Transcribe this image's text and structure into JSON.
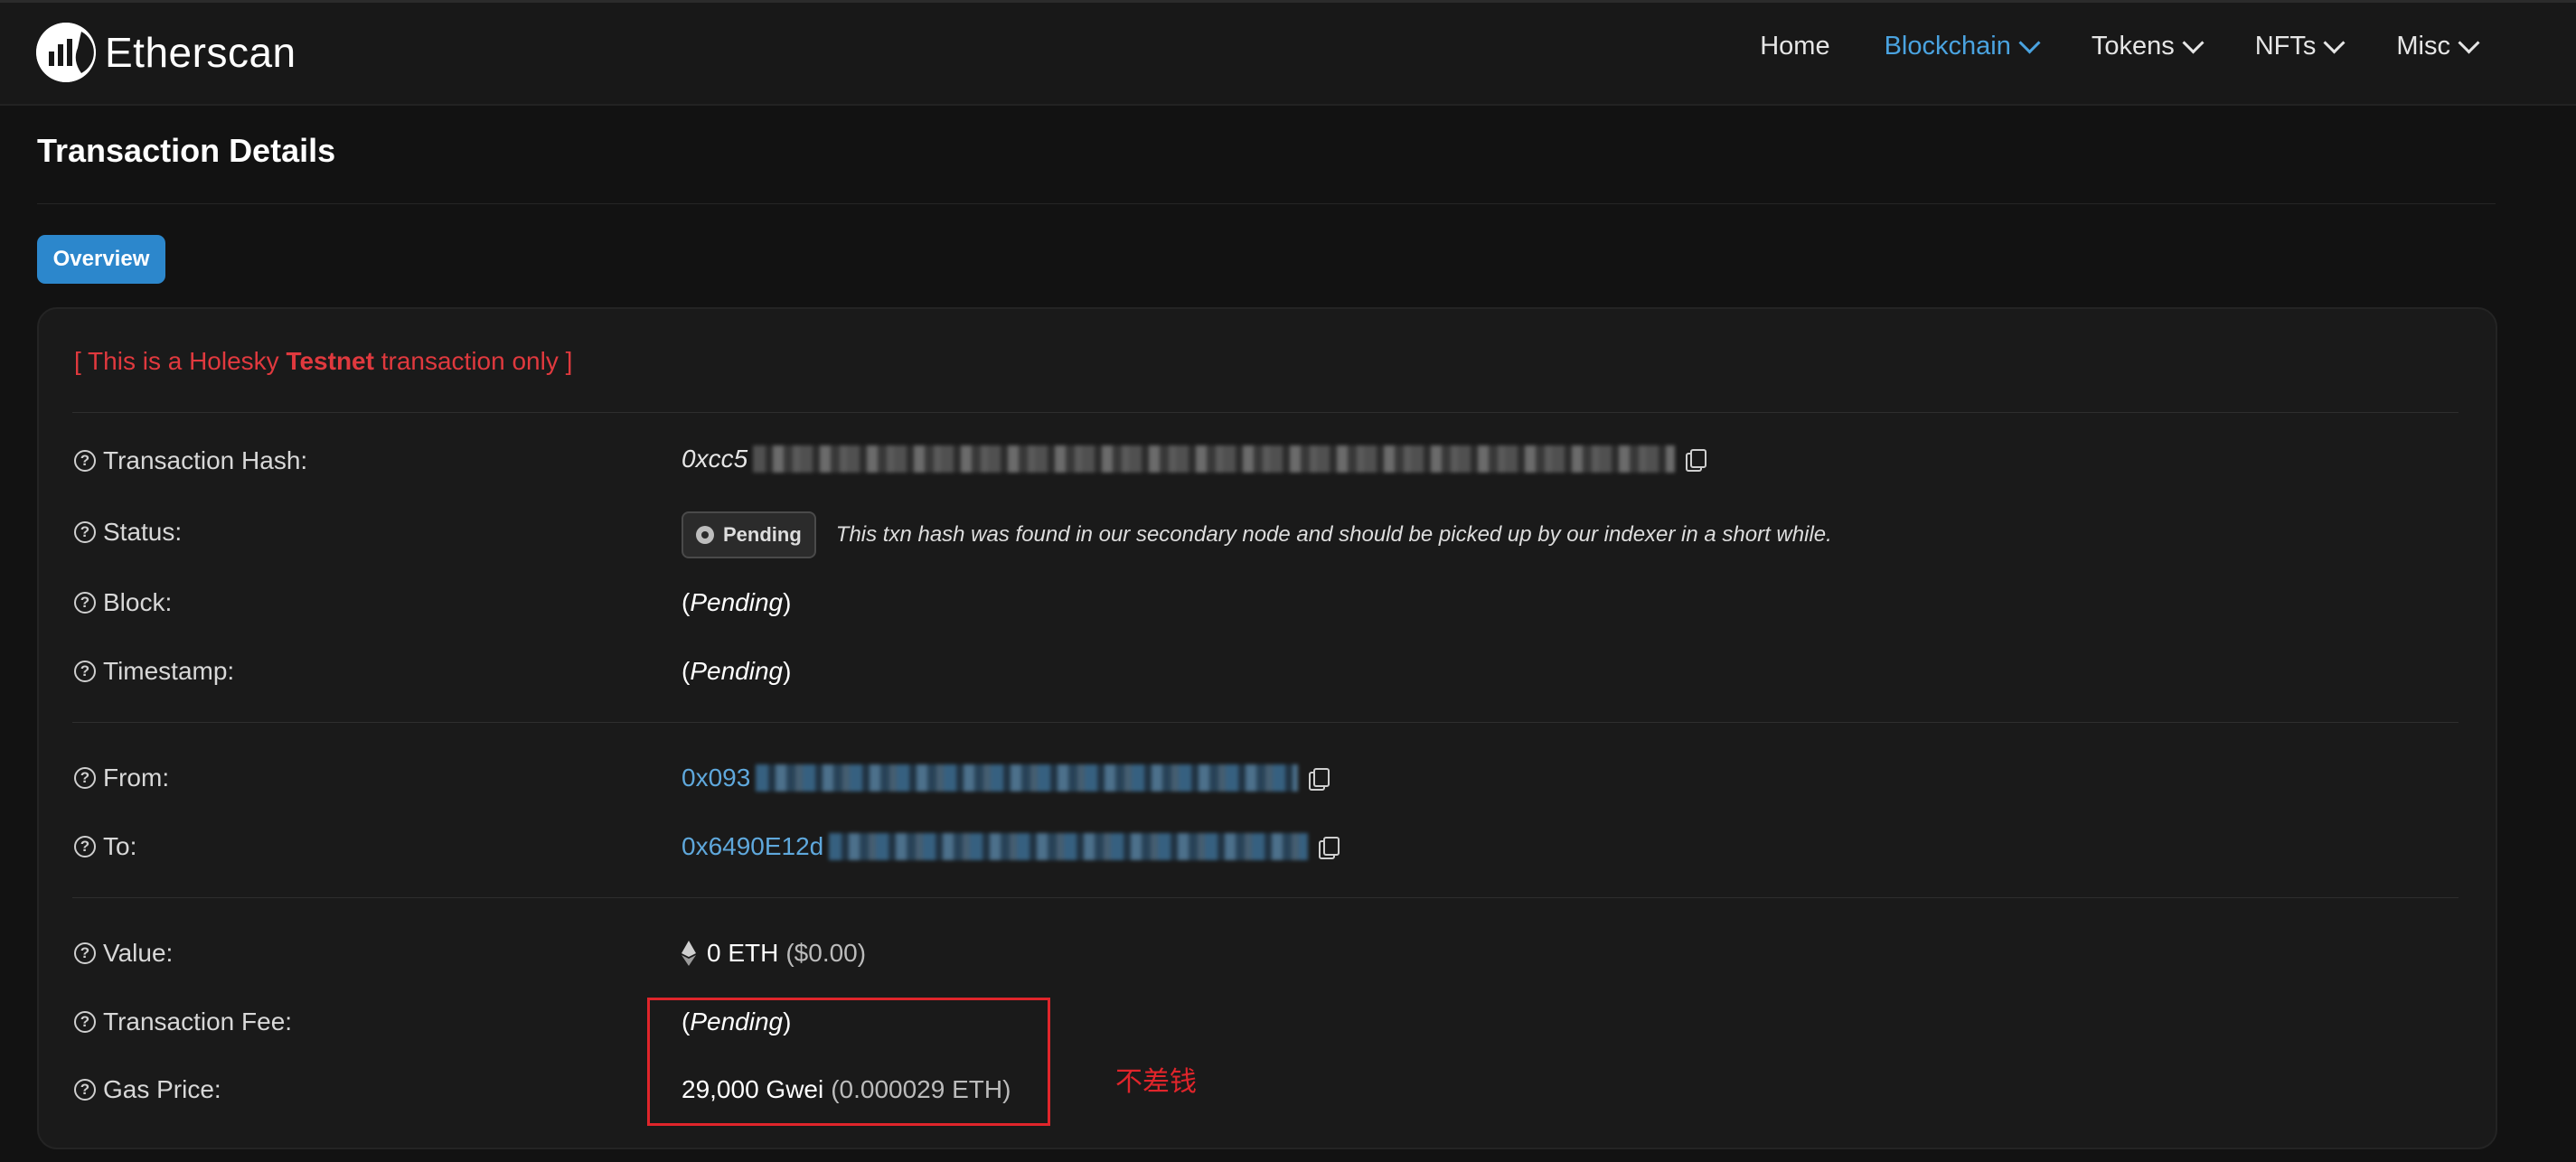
{
  "header": {
    "brand": "Etherscan",
    "nav": [
      {
        "label": "Home",
        "dropdown": false,
        "active": false
      },
      {
        "label": "Blockchain",
        "dropdown": true,
        "active": true
      },
      {
        "label": "Tokens",
        "dropdown": true,
        "active": false
      },
      {
        "label": "NFTs",
        "dropdown": true,
        "active": false
      },
      {
        "label": "Misc",
        "dropdown": true,
        "active": false
      }
    ]
  },
  "page": {
    "title": "Transaction Details",
    "tab": "Overview"
  },
  "notice": {
    "prefix": "[ This is a Holesky ",
    "bold": "Testnet",
    "suffix": " transaction only ]"
  },
  "details": {
    "tx_hash": {
      "label": "Transaction Hash:",
      "value_visible": "0xcc5"
    },
    "status": {
      "label": "Status:",
      "badge": "Pending",
      "message": "This txn hash was found in our secondary node and should be picked up by our indexer in a short while."
    },
    "block": {
      "label": "Block:",
      "open": "(",
      "value": "Pending",
      "close": ")"
    },
    "timestamp": {
      "label": "Timestamp:",
      "open": "(",
      "value": "Pending",
      "close": ")"
    },
    "from": {
      "label": "From:",
      "value_visible": "0x093"
    },
    "to": {
      "label": "To:",
      "value_visible": "0x6490E12d"
    },
    "value": {
      "label": "Value:",
      "amount": "0 ETH",
      "usd": "($0.00)"
    },
    "fee": {
      "label": "Transaction Fee:",
      "open": "(",
      "value": "Pending",
      "close": ")"
    },
    "gas_price": {
      "label": "Gas Price:",
      "gwei": "29,000 Gwei",
      "eth": "(0.000029 ETH)"
    }
  },
  "annotation": {
    "text": "不差钱",
    "color": "#e0252b"
  },
  "colors": {
    "accent": "#2c87cc",
    "link": "#5fa8dc",
    "notice": "#e0393e",
    "background": "#121212"
  }
}
